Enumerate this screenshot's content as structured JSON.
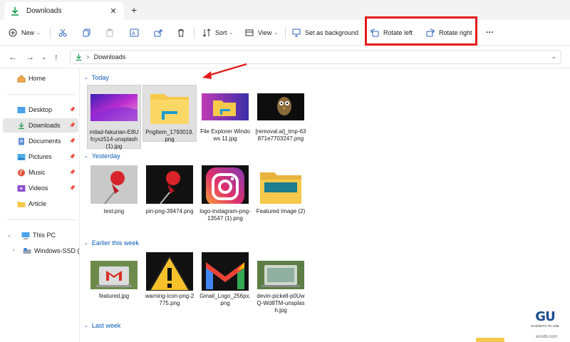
{
  "tab": {
    "title": "Downloads",
    "close": "✕",
    "new_tab": "+"
  },
  "toolbar": {
    "new_label": "New",
    "sort_label": "Sort",
    "view_label": "View",
    "set_background_label": "Set as background",
    "rotate_left_label": "Rotate left",
    "rotate_right_label": "Rotate right",
    "more_label": "···"
  },
  "address": {
    "folder": "Downloads",
    "separator": ">"
  },
  "sidebar": {
    "home": "Home",
    "desktop": "Desktop",
    "downloads": "Downloads",
    "documents": "Documents",
    "pictures": "Pictures",
    "music": "Music",
    "videos": "Videos",
    "article": "Article",
    "this_pc": "This PC",
    "windows_ssd": "Windows-SSD (C:"
  },
  "groups": {
    "today": "Today",
    "yesterday": "Yesterday",
    "earlier": "Earlier this week",
    "last_week": "Last week"
  },
  "files": {
    "f1": "milad-fakurian-E8Ufcyxz514-unsplash (1).jpg",
    "f2": "PngItem_1793019.png",
    "f3": "File Explorer Windows 11.jpg",
    "f4": "[removal.ai]_tmp-63871e7703247.png",
    "f5": "test.png",
    "f6": "pin-png-39474.png",
    "f7": "logo-instagram-png-13547 (1).png",
    "f8": "Featured Image (2)",
    "f9": "featured.jpg",
    "f10": "warning-icon-png-2775.png",
    "f11": "Gmail_Logo_256px.png",
    "f12": "devin-pickell-p0UwQ-Wd8TM-unsplash.jpg"
  },
  "watermark": {
    "logo": "GU",
    "tagline": "GADGETS TO USE",
    "site": "wsxdn.com"
  },
  "colors": {
    "highlight": "#e41c1c",
    "accent": "#0a5bb5",
    "folder": "#f6c94b"
  }
}
